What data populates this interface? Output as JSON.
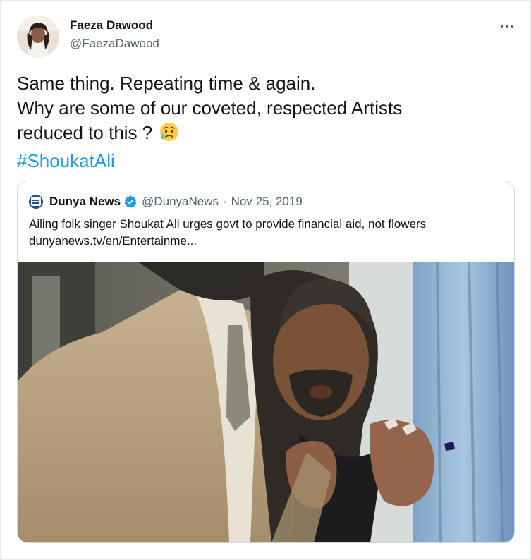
{
  "author": {
    "name": "Faeza Dawood",
    "handle": "@FaezaDawood"
  },
  "tweet": {
    "line1": "Same thing. Repeating time & again.",
    "line2": "Why are some of our coveted, respected Artists",
    "line3": "reduced to this ?",
    "emoji": "sad-but-relieved-face-icon",
    "hashtag": "#ShoukatAli"
  },
  "quoted": {
    "name": "Dunya News",
    "handle": "@DunyaNews",
    "separator": "·",
    "date": "Nov 25, 2019",
    "text": "Ailing folk singer Shoukat Ali urges govt to provide financial aid, not flowers",
    "link": "dunyanews.tv/en/Entertainme..."
  },
  "colors": {
    "accent": "#1d9bf0",
    "text": "#0f1419",
    "muted": "#536471",
    "border": "#cfd9de"
  }
}
